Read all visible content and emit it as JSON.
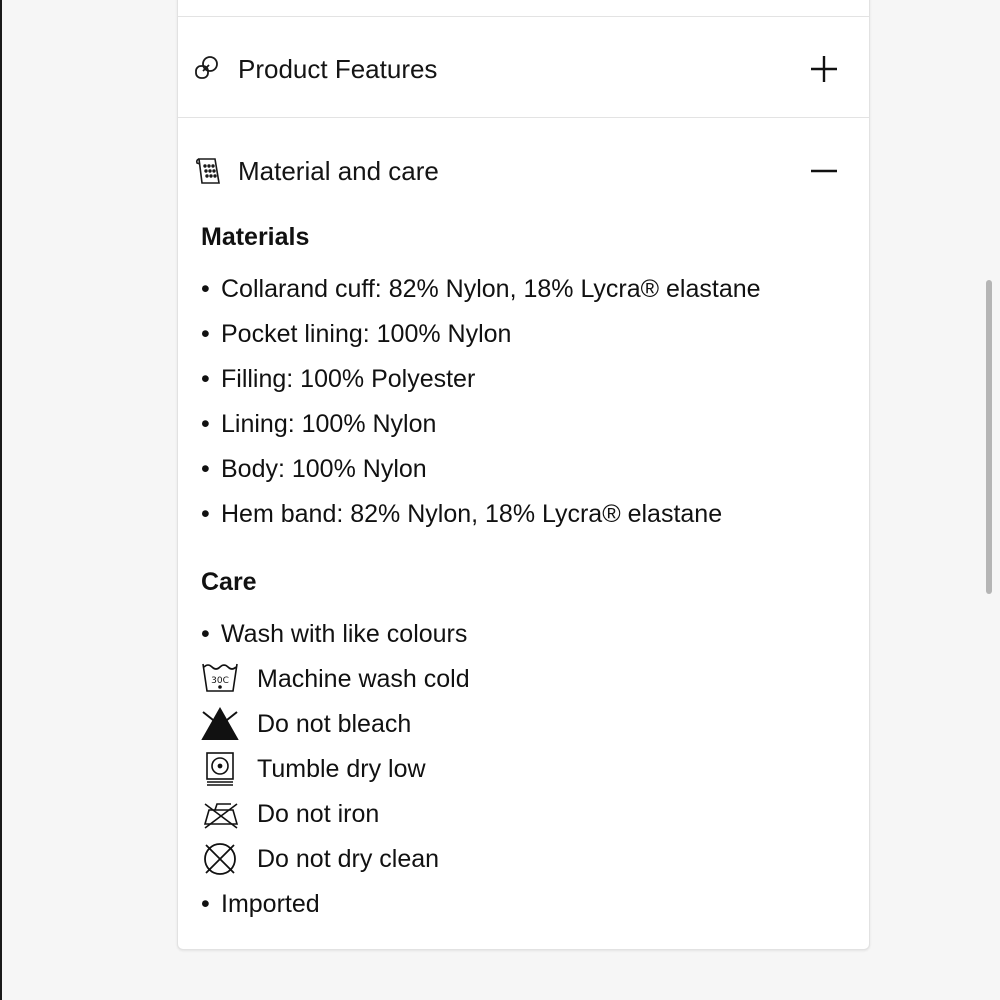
{
  "accordion": {
    "product_features": {
      "label": "Product Features",
      "icon": "product-features-icon",
      "toggle": "plus-icon",
      "expanded": false
    },
    "material_care": {
      "label": "Material and care",
      "icon": "material-care-icon",
      "toggle": "minus-icon",
      "expanded": true,
      "materials_heading": "Materials",
      "materials": [
        "Collarand cuff: 82% Nylon, 18% Lycra® elastane",
        "Pocket lining: 100% Nylon",
        "Filling: 100% Polyester",
        "Lining: 100% Nylon",
        "Body: 100% Nylon",
        "Hem band: 82% Nylon, 18% Lycra® elastane"
      ],
      "care_heading": "Care",
      "care": [
        {
          "text": "Wash with like colours",
          "icon": "bullet"
        },
        {
          "text": "Machine wash cold",
          "icon": "wash-30c-icon",
          "icon_text": "30C"
        },
        {
          "text": "Do not bleach",
          "icon": "do-not-bleach-icon"
        },
        {
          "text": "Tumble dry low",
          "icon": "tumble-dry-low-icon"
        },
        {
          "text": "Do not iron",
          "icon": "do-not-iron-icon"
        },
        {
          "text": "Do not dry clean",
          "icon": "do-not-dry-clean-icon"
        },
        {
          "text": "Imported",
          "icon": "bullet"
        }
      ]
    }
  },
  "colors": {
    "background": "#f6f6f6",
    "card": "#ffffff",
    "text": "#111111",
    "divider": "#e3e3e3",
    "scrollbar": "#b5b5b5"
  }
}
